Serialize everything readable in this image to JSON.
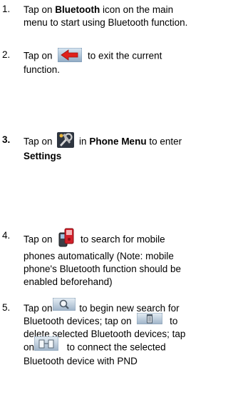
{
  "steps": [
    {
      "number": "1.",
      "parts": [
        "Tap on ",
        "Bluetooth",
        " icon on the main menu to start using Bluetooth function."
      ]
    },
    {
      "number": "2.",
      "parts": [
        "Tap on ",
        " to exit the current function."
      ],
      "icon": "back-arrow-icon"
    },
    {
      "number": "3.",
      "parts": [
        "Tap on ",
        " in ",
        "Phone Menu",
        " to enter ",
        "Settings"
      ],
      "icon": "settings-tools-icon"
    },
    {
      "number": "4.",
      "parts": [
        "Tap on ",
        " to search for mobile phones automatically (Note: mobile phone's Bluetooth function should be enabled beforehand)"
      ],
      "icon": "phone-search-icon"
    },
    {
      "number": "5.",
      "parts": [
        "Tap on",
        " to begin new search for Bluetooth devices; tap on ",
        " to delete selected Bluetooth devices; tap on",
        " to connect the selected Bluetooth device with PND"
      ],
      "icons": [
        "search-icon",
        "trash-icon",
        "connect-icon"
      ]
    }
  ]
}
